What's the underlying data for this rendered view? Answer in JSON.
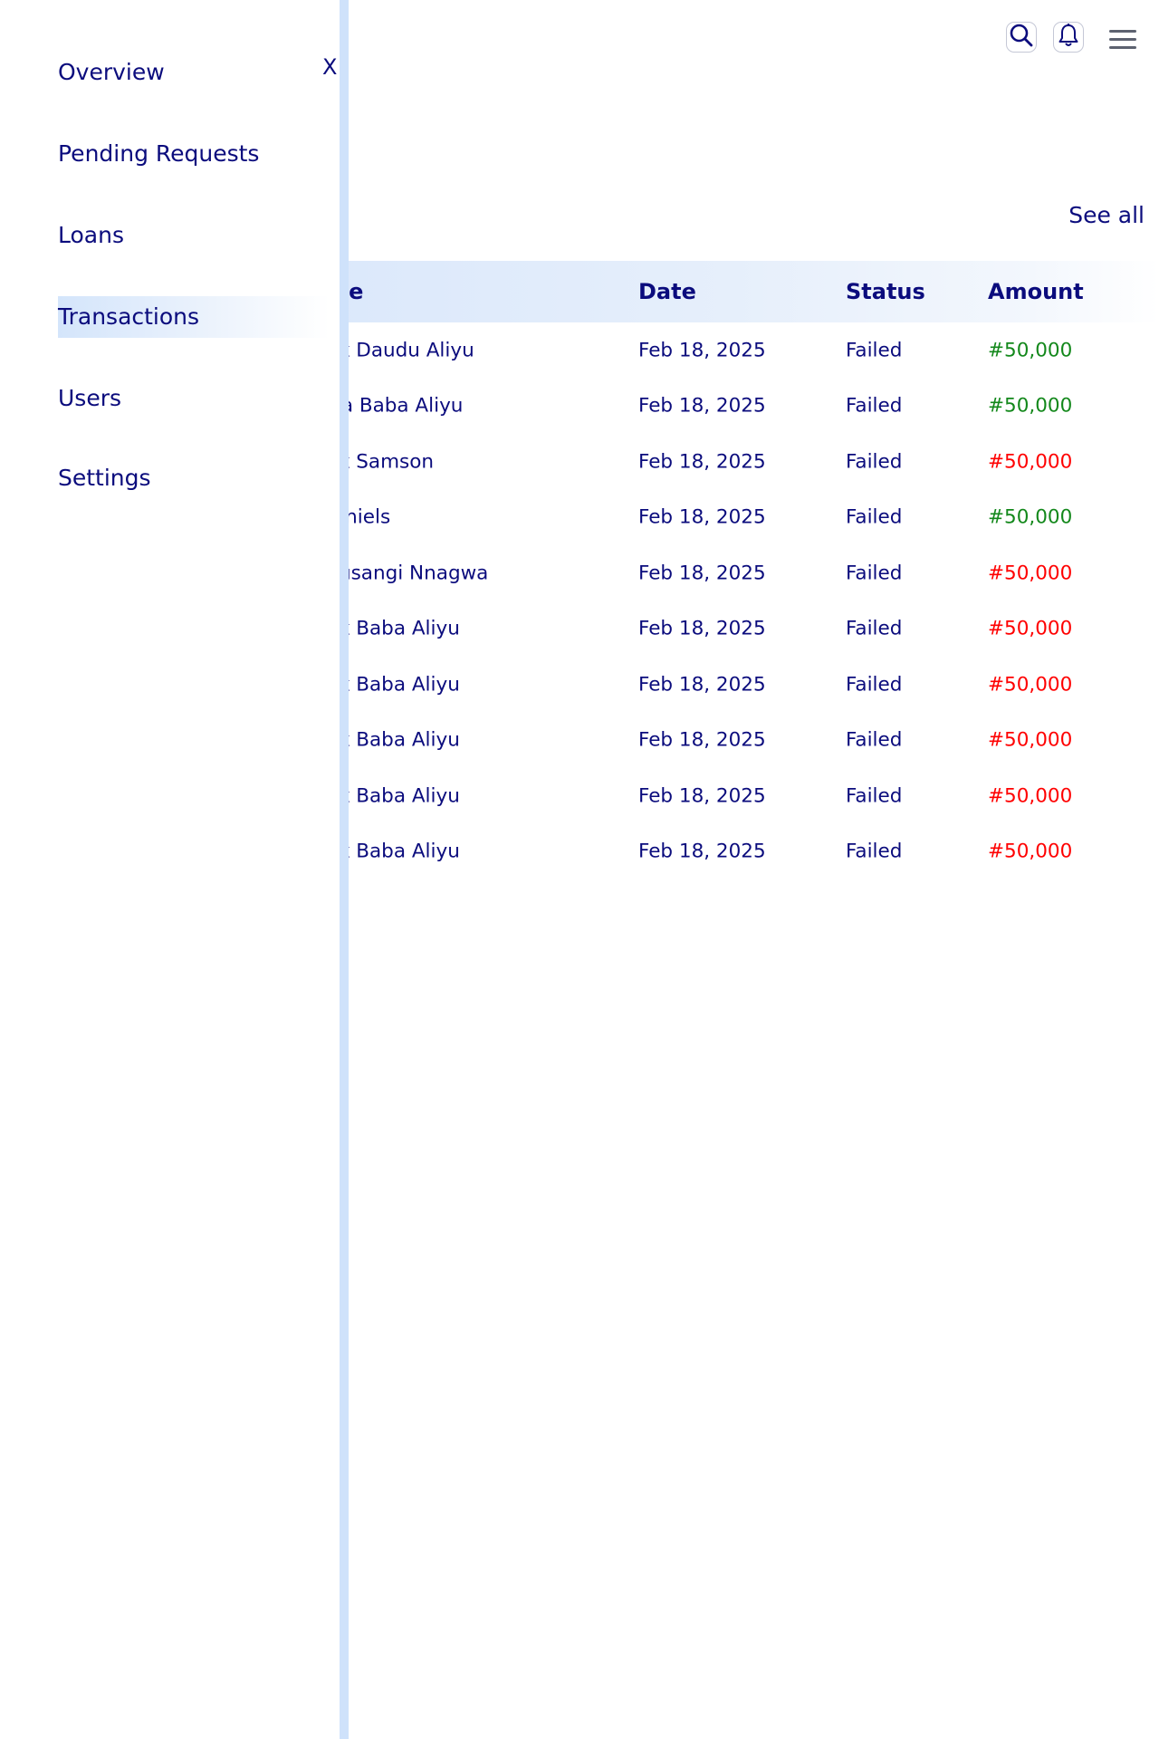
{
  "header": {
    "search_icon": "search-icon",
    "bell_icon": "bell-icon",
    "menu_icon": "hamburger-menu-icon"
  },
  "transactions": {
    "see_all": "See all",
    "columns": [
      "ne",
      "Date",
      "Status",
      "Amount"
    ],
    "rows": [
      {
        "name": "ık Daudu Aliyu",
        "date": "Feb 18, 2025",
        "status": "Failed",
        "amount": "#50,000",
        "amount_color": "green"
      },
      {
        "name": "ra Baba Aliyu",
        "date": "Feb 18, 2025",
        "status": "Failed",
        "amount": "#50,000",
        "amount_color": "green"
      },
      {
        "name": "ık Samson",
        "date": "Feb 18, 2025",
        "status": "Failed",
        "amount": "#50,000",
        "amount_color": "red"
      },
      {
        "name": "aniels",
        "date": "Feb 18, 2025",
        "status": "Failed",
        "amount": "#50,000",
        "amount_color": "green"
      },
      {
        "name": "ıusangi Nnagwa",
        "date": "Feb 18, 2025",
        "status": "Failed",
        "amount": "#50,000",
        "amount_color": "red"
      },
      {
        "name": "ık Baba Aliyu",
        "date": "Feb 18, 2025",
        "status": "Failed",
        "amount": "#50,000",
        "amount_color": "red"
      },
      {
        "name": "ık Baba Aliyu",
        "date": "Feb 18, 2025",
        "status": "Failed",
        "amount": "#50,000",
        "amount_color": "red"
      },
      {
        "name": "ık Baba Aliyu",
        "date": "Feb 18, 2025",
        "status": "Failed",
        "amount": "#50,000",
        "amount_color": "red"
      },
      {
        "name": "ık Baba Aliyu",
        "date": "Feb 18, 2025",
        "status": "Failed",
        "amount": "#50,000",
        "amount_color": "red"
      },
      {
        "name": "ık Baba Aliyu",
        "date": "Feb 18, 2025",
        "status": "Failed",
        "amount": "#50,000",
        "amount_color": "red"
      }
    ]
  },
  "drawer": {
    "close_label": "X",
    "items": [
      {
        "label": "Overview",
        "active": false
      },
      {
        "label": "Pending Requests",
        "active": false
      },
      {
        "label": "Loans",
        "active": false
      },
      {
        "label": "Transactions",
        "active": true
      },
      {
        "label": "Users",
        "active": false
      },
      {
        "label": "Settings",
        "active": false
      }
    ]
  },
  "colors": {
    "text": "#0b0c7d",
    "amount_green": "#13881b",
    "amount_red": "#ff0000",
    "drawer_edge": "#cfe2fb",
    "header_gradient": "#dbe8fb"
  }
}
